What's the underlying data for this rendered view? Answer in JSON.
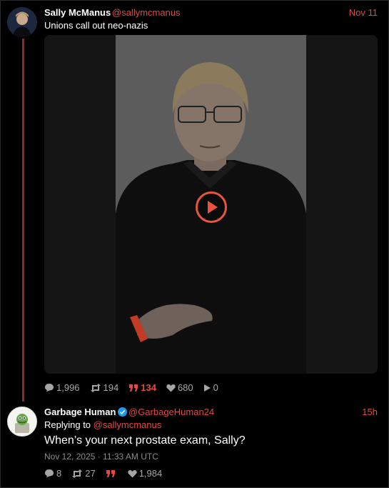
{
  "tweet1": {
    "author_name": "Sally McManus",
    "author_handle": "@sallymcmanus",
    "time": "Nov 11",
    "text": "Unions call out neo-nazis",
    "stats": {
      "replies": "1,996",
      "retweets": "194",
      "quotes": "134",
      "likes": "680",
      "views": "0"
    }
  },
  "tweet2": {
    "author_name": "Garbage Human",
    "author_handle": "@GarbageHuman24",
    "time": "15h",
    "replying_label": "Replying to",
    "replying_handle": "@sallymcmanus",
    "text": "When’s your next prostate exam, Sally?",
    "date": "Nov 12, 2025 · 11:33 AM UTC",
    "stats": {
      "replies": "8",
      "retweets": "27",
      "quotes": "",
      "likes": "1,984"
    }
  },
  "colors": {
    "accent": "#e04b44",
    "thread_line": "#8f2a2a",
    "muted": "#a6a6a6",
    "background": "#000000"
  },
  "icons": {
    "reply": "comment-icon",
    "retweet": "retweet-icon",
    "quote": "quote-icon",
    "like": "heart-icon",
    "views": "play-icon",
    "verified": "verified-badge-icon"
  }
}
